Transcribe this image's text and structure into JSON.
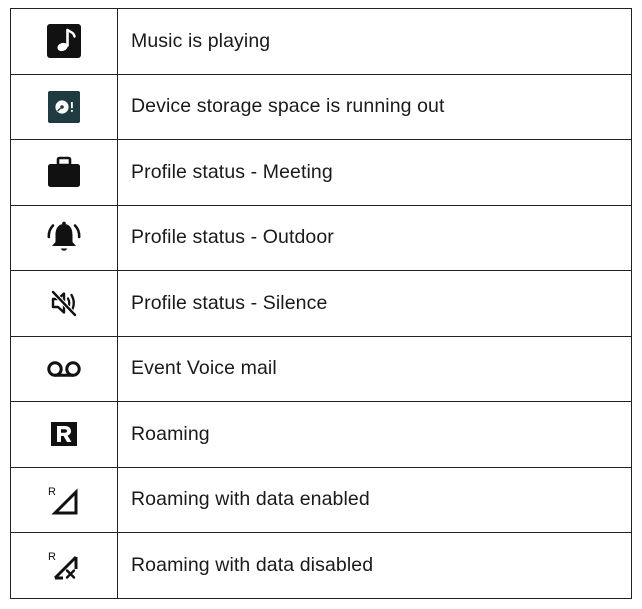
{
  "rows": [
    {
      "icon": "music-note-icon",
      "description": "Music is playing"
    },
    {
      "icon": "storage-warning-icon",
      "description": "Device storage space is running out"
    },
    {
      "icon": "briefcase-icon",
      "description": "Profile status - Meeting"
    },
    {
      "icon": "ringing-bell-icon",
      "description": "Profile status - Outdoor"
    },
    {
      "icon": "speaker-muted-icon",
      "description": "Profile status - Silence"
    },
    {
      "icon": "voicemail-icon",
      "description": "Event Voice mail"
    },
    {
      "icon": "roaming-r-icon",
      "description": "Roaming"
    },
    {
      "icon": "roaming-signal-data-enabled-icon",
      "description": "Roaming with data enabled"
    },
    {
      "icon": "roaming-signal-data-disabled-icon",
      "description": "Roaming with data disabled"
    }
  ],
  "colors": {
    "icon_dark": "#111111",
    "storage_icon_bg": "#1f3a40",
    "border": "#222222",
    "text": "#1a1a1a"
  }
}
